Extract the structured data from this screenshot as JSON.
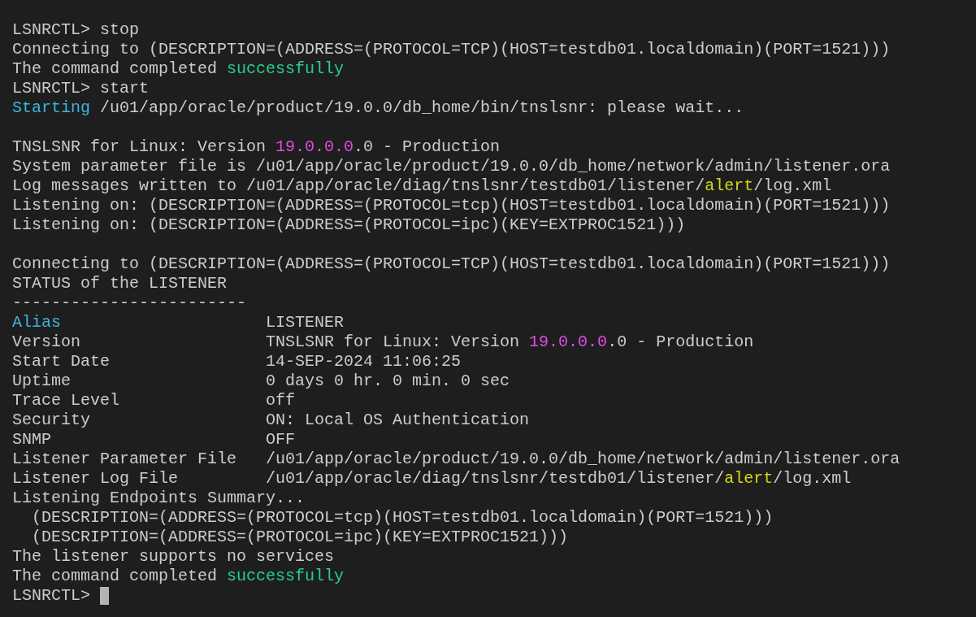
{
  "terminal": {
    "lines": [
      {
        "kind": "text",
        "cursor": false,
        "segments": [
          {
            "text": "LSNRCTL> stop"
          }
        ]
      },
      {
        "kind": "text",
        "cursor": false,
        "segments": [
          {
            "text": "Connecting to (DESCRIPTION=(ADDRESS=(PROTOCOL=TCP)(HOST=testdb01.localdomain)(PORT=1521)))"
          }
        ]
      },
      {
        "kind": "text",
        "cursor": false,
        "segments": [
          {
            "text": "The command completed "
          },
          {
            "text": "successfully",
            "color": "#23d18b"
          }
        ]
      },
      {
        "kind": "text",
        "cursor": false,
        "segments": [
          {
            "text": "LSNRCTL> start"
          }
        ]
      },
      {
        "kind": "text",
        "cursor": false,
        "segments": [
          {
            "text": "Starting",
            "color": "#3ab7e0"
          },
          {
            "text": " /u01/app/oracle/product/19.0.0/db_home/bin/tnslsnr: please wait..."
          }
        ]
      },
      {
        "kind": "blank",
        "cursor": false
      },
      {
        "kind": "text",
        "cursor": false,
        "segments": [
          {
            "text": "TNSLSNR for Linux: Version "
          },
          {
            "text": "19.0.0.0",
            "color": "#e34ce6"
          },
          {
            "text": ".0 - Production"
          }
        ]
      },
      {
        "kind": "text",
        "cursor": false,
        "segments": [
          {
            "text": "System parameter file is /u01/app/oracle/product/19.0.0/db_home/network/admin/listener.ora"
          }
        ]
      },
      {
        "kind": "text",
        "cursor": false,
        "segments": [
          {
            "text": "Log messages written to /u01/app/oracle/diag/tnslsnr/testdb01/listener/"
          },
          {
            "text": "alert",
            "color": "#d6d61a"
          },
          {
            "text": "/log.xml"
          }
        ]
      },
      {
        "kind": "text",
        "cursor": false,
        "segments": [
          {
            "text": "Listening on: (DESCRIPTION=(ADDRESS=(PROTOCOL=tcp)(HOST=testdb01.localdomain)(PORT=1521)))"
          }
        ]
      },
      {
        "kind": "text",
        "cursor": false,
        "segments": [
          {
            "text": "Listening on: (DESCRIPTION=(ADDRESS=(PROTOCOL=ipc)(KEY=EXTPROC1521)))"
          }
        ]
      },
      {
        "kind": "blank",
        "cursor": false
      },
      {
        "kind": "text",
        "cursor": false,
        "segments": [
          {
            "text": "Connecting to (DESCRIPTION=(ADDRESS=(PROTOCOL=TCP)(HOST=testdb01.localdomain)(PORT=1521)))"
          }
        ]
      },
      {
        "kind": "text",
        "cursor": false,
        "segments": [
          {
            "text": "STATUS of the LISTENER"
          }
        ]
      },
      {
        "kind": "text",
        "cursor": false,
        "segments": [
          {
            "text": "------------------------"
          }
        ]
      },
      {
        "kind": "text",
        "cursor": false,
        "segments": [
          {
            "text": "Alias",
            "color": "#3ab7e0"
          },
          {
            "text": "                     LISTENER"
          }
        ]
      },
      {
        "kind": "text",
        "cursor": false,
        "segments": [
          {
            "text": "Version                   TNSLSNR for Linux: Version "
          },
          {
            "text": "19.0.0.0",
            "color": "#e34ce6"
          },
          {
            "text": ".0 - Production"
          }
        ]
      },
      {
        "kind": "text",
        "cursor": false,
        "segments": [
          {
            "text": "Start Date                14-SEP-2024 11:06:25"
          }
        ]
      },
      {
        "kind": "text",
        "cursor": false,
        "segments": [
          {
            "text": "Uptime                    0 days 0 hr. 0 min. 0 sec"
          }
        ]
      },
      {
        "kind": "text",
        "cursor": false,
        "segments": [
          {
            "text": "Trace Level               off"
          }
        ]
      },
      {
        "kind": "text",
        "cursor": false,
        "segments": [
          {
            "text": "Security                  ON: Local OS Authentication"
          }
        ]
      },
      {
        "kind": "text",
        "cursor": false,
        "segments": [
          {
            "text": "SNMP                      OFF"
          }
        ]
      },
      {
        "kind": "text",
        "cursor": false,
        "segments": [
          {
            "text": "Listener Parameter File   /u01/app/oracle/product/19.0.0/db_home/network/admin/listener.ora"
          }
        ]
      },
      {
        "kind": "text",
        "cursor": false,
        "segments": [
          {
            "text": "Listener Log File         /u01/app/oracle/diag/tnslsnr/testdb01/listener/"
          },
          {
            "text": "alert",
            "color": "#d6d61a"
          },
          {
            "text": "/log.xml"
          }
        ]
      },
      {
        "kind": "text",
        "cursor": false,
        "segments": [
          {
            "text": "Listening Endpoints Summary..."
          }
        ]
      },
      {
        "kind": "text",
        "cursor": false,
        "segments": [
          {
            "text": "  (DESCRIPTION=(ADDRESS=(PROTOCOL=tcp)(HOST=testdb01.localdomain)(PORT=1521)))"
          }
        ]
      },
      {
        "kind": "text",
        "cursor": false,
        "segments": [
          {
            "text": "  (DESCRIPTION=(ADDRESS=(PROTOCOL=ipc)(KEY=EXTPROC1521)))"
          }
        ]
      },
      {
        "kind": "text",
        "cursor": false,
        "segments": [
          {
            "text": "The listener supports no services"
          }
        ]
      },
      {
        "kind": "text",
        "cursor": false,
        "segments": [
          {
            "text": "The command completed "
          },
          {
            "text": "successfully",
            "color": "#23d18b"
          }
        ]
      },
      {
        "kind": "text",
        "cursor": true,
        "segments": [
          {
            "text": "LSNRCTL> "
          }
        ]
      }
    ]
  }
}
